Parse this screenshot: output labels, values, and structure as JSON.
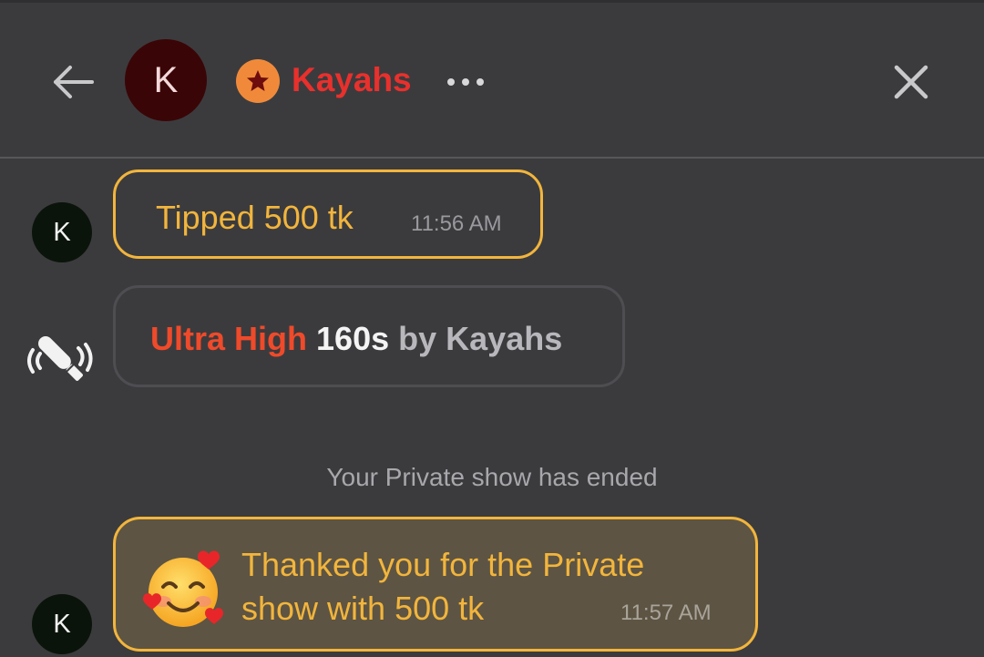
{
  "header": {
    "back_icon": "arrow-left-icon",
    "avatar_initial": "K",
    "badge_icon": "star-icon",
    "name": "Kayahs",
    "name_color": "#e8302c",
    "more_icon": "more-horizontal-icon",
    "close_icon": "close-icon"
  },
  "messages": [
    {
      "type": "tip",
      "avatar_initial": "K",
      "text": "Tipped 500 tk",
      "time": "11:56 AM",
      "accent": "#f2b53c"
    },
    {
      "type": "toy",
      "icon": "vibrator-toy-icon",
      "level": "Ultra High",
      "duration": "160s",
      "by": "by Kayahs",
      "level_color": "#ef4a2a"
    },
    {
      "type": "system",
      "text": "Your Private show has ended"
    },
    {
      "type": "thanks",
      "avatar_initial": "K",
      "emoji": "smiling-face-with-hearts-icon",
      "text": "Thanked you for the Private show with 500 tk",
      "time": "11:57 AM",
      "accent": "#f2b53c"
    }
  ],
  "colors": {
    "background": "#3b3b3e",
    "divider": "#57575b",
    "accent": "#f2b53c"
  }
}
